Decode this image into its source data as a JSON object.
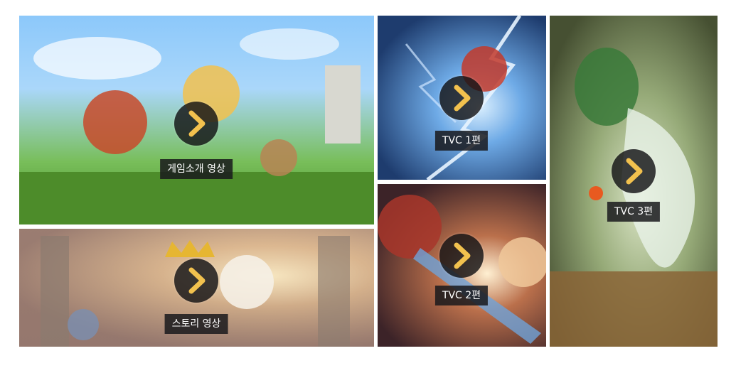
{
  "tiles": [
    {
      "id": "intro",
      "label": "게임소개 영상"
    },
    {
      "id": "story",
      "label": "스토리 영상"
    },
    {
      "id": "tvc1",
      "label": "TVC 1편"
    },
    {
      "id": "tvc2",
      "label": "TVC 2편"
    },
    {
      "id": "tvc3",
      "label": "TVC 3편"
    }
  ],
  "colors": {
    "play_arrow": "#f2c14e",
    "play_bg": "#141416",
    "label_bg": "#19191c",
    "label_text": "#ffffff"
  },
  "icons": {
    "play": "play-icon"
  }
}
